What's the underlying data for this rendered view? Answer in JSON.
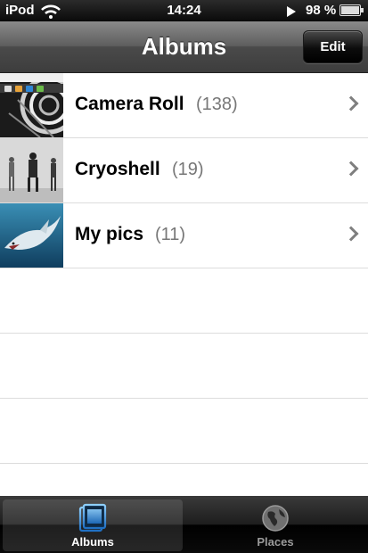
{
  "status_bar": {
    "carrier": "iPod",
    "time": "14:24",
    "battery_percent": "98 %",
    "battery_level": 0.98
  },
  "nav": {
    "title": "Albums",
    "edit_label": "Edit"
  },
  "albums": [
    {
      "name": "Camera Roll",
      "count": "(138)"
    },
    {
      "name": "Cryoshell",
      "count": "(19)"
    },
    {
      "name": "My pics",
      "count": "(11)"
    }
  ],
  "tabs": [
    {
      "label": "Albums",
      "icon": "albums-icon",
      "active": true
    },
    {
      "label": "Places",
      "icon": "globe-icon",
      "active": false
    }
  ],
  "colors": {
    "accent": "#3a8fd6",
    "inactive_tab": "#9a9a9a"
  }
}
